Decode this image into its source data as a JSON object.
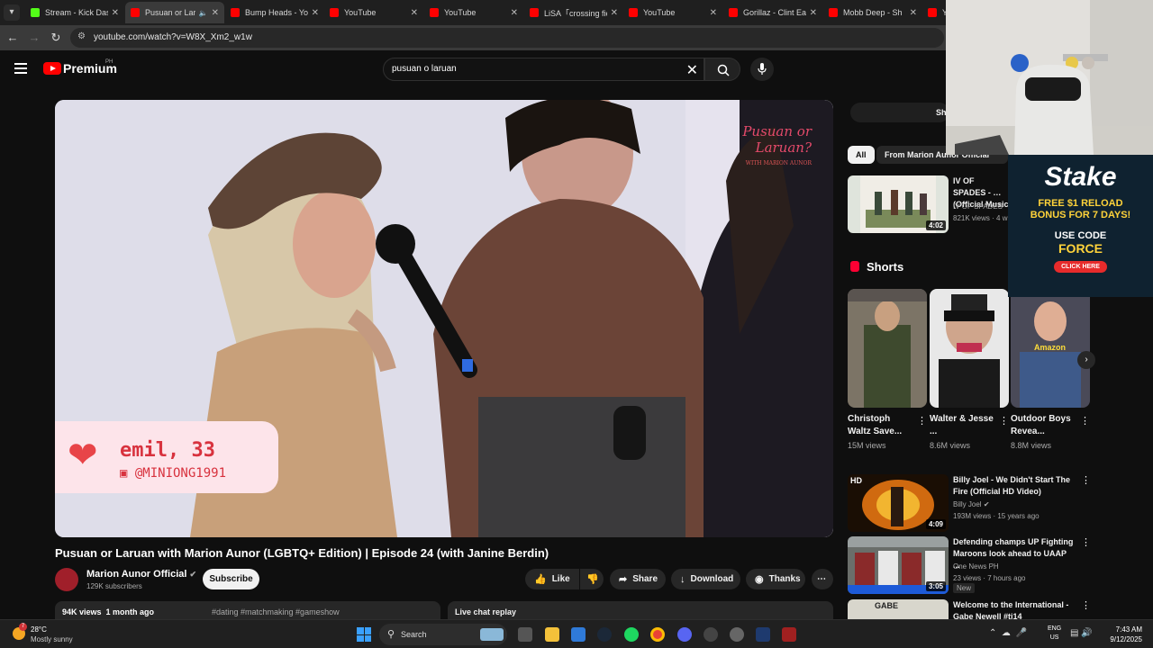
{
  "browser": {
    "tabs": [
      {
        "title": "Stream - Kick Das",
        "type": "kick"
      },
      {
        "title": "Pusuan or Lar",
        "type": "yt",
        "active": true
      },
      {
        "title": "Bump Heads - Yo",
        "type": "yt"
      },
      {
        "title": "YouTube",
        "type": "yt"
      },
      {
        "title": "YouTube",
        "type": "yt"
      },
      {
        "title": "LiSA「crossing fie",
        "type": "yt"
      },
      {
        "title": "YouTube",
        "type": "yt"
      },
      {
        "title": "Gorillaz - Clint Ea",
        "type": "yt"
      },
      {
        "title": "Mobb Deep - Sh",
        "type": "yt"
      },
      {
        "title": "Yo",
        "type": "yt"
      }
    ],
    "url": "youtube.com/watch?v=W8X_Xm2_w1w"
  },
  "youtube": {
    "brand": "Premium",
    "region": "PH",
    "search_query": "pusuan o laruan"
  },
  "video": {
    "overlay_name": "emil, 33",
    "overlay_handle": "@MINIONG1991",
    "watermark_line1": "Pusuan or",
    "watermark_line2": "Laruan?",
    "watermark_small": "WITH MARION AUNOR",
    "title": "Pusuan or Laruan with Marion Aunor (LGBTQ+ Edition) | Episode 24 (with Janine Berdin)",
    "channel": "Marion Aunor Official",
    "subscribers": "129K subscribers",
    "subscribe_label": "Subscribe",
    "like_label": "Like",
    "share_label": "Share",
    "download_label": "Download",
    "thanks_label": "Thanks",
    "views": "94K views",
    "age": "1 month ago",
    "hashtags": "#dating #matchmaking #gameshow",
    "chat_replay": "Live chat replay"
  },
  "sidebar": {
    "share_partial": "Sh",
    "chips": [
      "All",
      "From Marion Aunor Official"
    ],
    "top_rec": {
      "title": "IV OF SPADES - … (Official Music",
      "channel": "IV OF SPADES",
      "meta": "821K views · 4 w",
      "duration": "4:02"
    },
    "shorts_label": "Shorts",
    "shorts": [
      {
        "title": "Christoph Waltz Save...",
        "views": "15M views"
      },
      {
        "title": "Walter & Jesse ...",
        "views": "8.6M views"
      },
      {
        "title": "Outdoor Boys Revea...",
        "views": "8.8M views"
      }
    ],
    "recs": [
      {
        "title": "Billy Joel - We Didn't Start The Fire (Official HD Video)",
        "channel": "Billy Joel",
        "meta": "193M views · 15 years ago",
        "duration": "4:09",
        "thumb_text": "HD"
      },
      {
        "title": "Defending champs UP Fighting Maroons look ahead to UAAP ...",
        "channel": "One News PH",
        "meta": "23 views · 7 hours ago",
        "duration": "3:05",
        "badge": "New"
      },
      {
        "title": "Welcome to the International - Gabe Newell #ti14",
        "channel": "",
        "meta": "",
        "thumb_text": "GABE"
      }
    ]
  },
  "ad": {
    "brand": "Stake",
    "line1": "FREE $1 RELOAD",
    "line2": "BONUS FOR 7 DAYS!",
    "code_label": "USE CODE",
    "code": "FORCE",
    "cta": "CLICK HERE",
    "amazon_label": "Amazon"
  },
  "taskbar": {
    "temp": "28°C",
    "condition": "Mostly sunny",
    "weather_badge": "7",
    "search_label": "Search",
    "lang1": "ENG",
    "lang2": "US",
    "time": "7:43 AM",
    "date": "9/12/2025"
  },
  "colors": {
    "accent": "#ff0000",
    "bg": "#0f0f0f",
    "chip": "#272727"
  }
}
